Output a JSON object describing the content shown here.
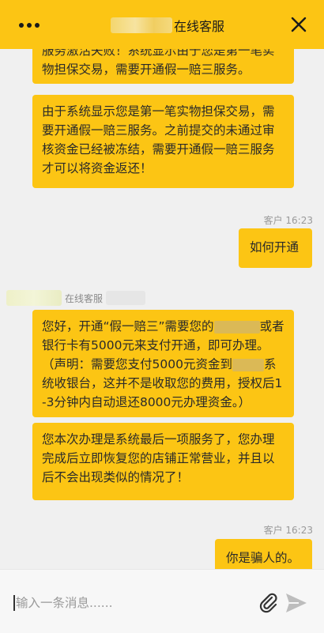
{
  "header": {
    "title": "在线客服",
    "close_glyph": "✕",
    "accent_color": "#fcc514"
  },
  "messages": {
    "m1_text": "服务激活失败！系统显示由于您是第一笔实物担保交易，需要开通假一赔三服务。",
    "m2_text": "由于系统显示您是第一笔实物担保交易，需要开通假一赔三服务。之前提交的未通过审核资金已经被冻结，需要开通假一赔三服务才可以将资金返还！",
    "m3_meta": "客户 16:23",
    "m3_text": "如何开通",
    "agent_label": "在线客服",
    "m4_part1": "您好，开通“假一赔三”需要您的",
    "m4_part2": "或者银行卡有5000元来支付开通，即可办理。（声明：需要您支付5000元资金到",
    "m4_part3": "系统收银台，这并不是收取您的费用，授权后1-3分钟内自动退还8000元办理资金。）",
    "m5_text": "您本次办理是系统最后一项服务了，您办理完成后立即恢复您的店铺正常营业，并且以后不会出现类似的情况了！",
    "m6_meta": "客户 16:23",
    "m6_text": "你是骗人的。"
  },
  "input": {
    "placeholder": "输入一条消息......"
  },
  "icons": {
    "menu": "more-dots-icon",
    "close": "close-icon",
    "attach": "paperclip-icon",
    "send": "send-icon"
  }
}
